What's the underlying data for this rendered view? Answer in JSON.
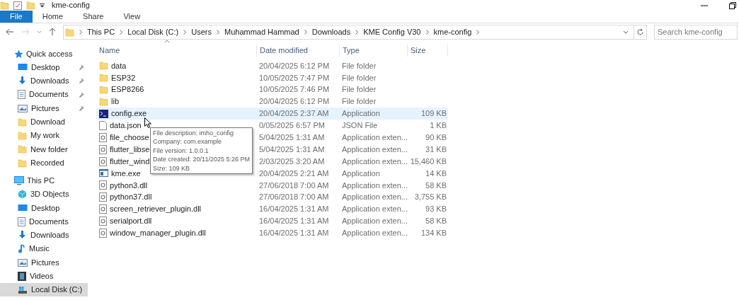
{
  "window": {
    "title": "kme-config"
  },
  "ribbon_tabs": [
    {
      "label": "File",
      "selected": true
    },
    {
      "label": "Home",
      "selected": false
    },
    {
      "label": "Share",
      "selected": false
    },
    {
      "label": "View",
      "selected": false
    }
  ],
  "breadcrumb": [
    "This PC",
    "Local Disk (C:)",
    "Users",
    "Muhammad Hammad",
    "Downloads",
    "KME Config V30",
    "kme-config"
  ],
  "search": {
    "placeholder": "Search kme-config"
  },
  "sidebar": {
    "groups": [
      {
        "label": "Quick access",
        "kind": "star",
        "items": [
          {
            "label": "Desktop",
            "kind": "desktop",
            "pinned": true,
            "selected": false
          },
          {
            "label": "Downloads",
            "kind": "download",
            "pinned": true,
            "selected": false
          },
          {
            "label": "Documents",
            "kind": "document",
            "pinned": true,
            "selected": false
          },
          {
            "label": "Pictures",
            "kind": "pictures",
            "pinned": true,
            "selected": false
          },
          {
            "label": "Download",
            "kind": "folder",
            "pinned": false,
            "selected": false
          },
          {
            "label": "My work",
            "kind": "folder",
            "pinned": false,
            "selected": false
          },
          {
            "label": "New folder",
            "kind": "folder",
            "pinned": false,
            "selected": false
          },
          {
            "label": "Recorded",
            "kind": "folder",
            "pinned": false,
            "selected": false
          }
        ]
      },
      {
        "label": "This PC",
        "kind": "pc",
        "items": [
          {
            "label": "3D Objects",
            "kind": "cube",
            "pinned": false,
            "selected": false
          },
          {
            "label": "Desktop",
            "kind": "desktop",
            "pinned": false,
            "selected": false
          },
          {
            "label": "Documents",
            "kind": "document",
            "pinned": false,
            "selected": false
          },
          {
            "label": "Downloads",
            "kind": "download",
            "pinned": false,
            "selected": false
          },
          {
            "label": "Music",
            "kind": "music",
            "pinned": false,
            "selected": false
          },
          {
            "label": "Pictures",
            "kind": "pictures",
            "pinned": false,
            "selected": false
          },
          {
            "label": "Videos",
            "kind": "video",
            "pinned": false,
            "selected": false
          },
          {
            "label": "Local Disk (C:)",
            "kind": "disk",
            "pinned": false,
            "selected": true
          }
        ]
      }
    ]
  },
  "table": {
    "columns": [
      "Name",
      "Date modified",
      "Type",
      "Size"
    ],
    "rows": [
      {
        "name": "data",
        "kind": "folder",
        "date": "20/04/2025 6:12 PM",
        "type": "File folder",
        "selected": false
      },
      {
        "name": "ESP32",
        "kind": "folder",
        "date": "10/05/2025 7:47 PM",
        "type": "File folder",
        "selected": false
      },
      {
        "name": "ESP8266",
        "kind": "folder",
        "date": "10/05/2025 7:46 PM",
        "type": "File folder",
        "selected": false
      },
      {
        "name": "lib",
        "kind": "folder",
        "date": "20/04/2025 6:12 PM",
        "type": "File folder",
        "selected": false
      },
      {
        "name": "config.exe",
        "kind": "console",
        "date": "20/04/2025 2:37 AM",
        "type": "Application",
        "size": "109 KB",
        "selected": true
      },
      {
        "name": "data.json",
        "kind": "file",
        "date": "0/05/2025 6:57 PM",
        "type": "JSON File",
        "size": "1 KB",
        "selected": false
      },
      {
        "name": "file_choose",
        "kind": "dll",
        "date": "5/04/2025 1:31 AM",
        "type": "Application exten...",
        "size": "90 KB",
        "selected": false
      },
      {
        "name": "flutter_libse",
        "kind": "dll",
        "date": "5/04/2025 1:31 AM",
        "type": "Application exten...",
        "size": "31 KB",
        "selected": false
      },
      {
        "name": "flutter_wind",
        "kind": "dll",
        "date": "2/03/2025 3:20 AM",
        "type": "Application exten...",
        "size": "15,460 KB",
        "selected": false
      },
      {
        "name": "kme.exe",
        "kind": "app",
        "date": "20/04/2025 2:21 AM",
        "type": "Application",
        "size": "14 KB",
        "selected": false
      },
      {
        "name": "python3.dll",
        "kind": "dll",
        "date": "27/06/2018 7:00 AM",
        "type": "Application exten...",
        "size": "58 KB",
        "selected": false
      },
      {
        "name": "python37.dll",
        "kind": "dll",
        "date": "27/06/2018 7:00 AM",
        "type": "Application exten...",
        "size": "3,755 KB",
        "selected": false
      },
      {
        "name": "screen_retriever_plugin.dll",
        "kind": "dll",
        "date": "16/04/2025 1:31 AM",
        "type": "Application exten...",
        "size": "93 KB",
        "selected": false
      },
      {
        "name": "serialport.dll",
        "kind": "dll",
        "date": "16/04/2025 1:31 AM",
        "type": "Application exten...",
        "size": "58 KB",
        "selected": false
      },
      {
        "name": "window_manager_plugin.dll",
        "kind": "dll",
        "date": "16/04/2025 1:31 AM",
        "type": "Application exten...",
        "size": "134 KB",
        "selected": false
      }
    ]
  },
  "tooltip": [
    "File description: imho_config",
    "Company: com.example",
    "File version: 1.0.0.1",
    "Date created: 20/11/2025 5:26 PM",
    "Size: 109 KB"
  ]
}
